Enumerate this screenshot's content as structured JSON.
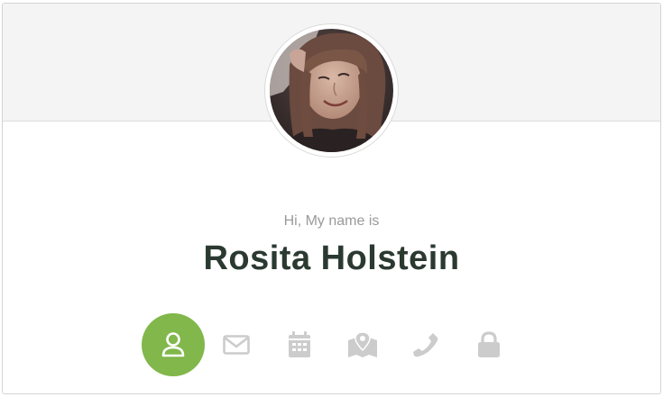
{
  "profile": {
    "greeting": "Hi, My name is",
    "name": "Rosita Holstein"
  },
  "nav_icons": [
    {
      "icon": "user-icon",
      "active": true
    },
    {
      "icon": "envelope-icon",
      "active": false
    },
    {
      "icon": "calendar-icon",
      "active": false
    },
    {
      "icon": "map-icon",
      "active": false
    },
    {
      "icon": "phone-icon",
      "active": false
    },
    {
      "icon": "lock-icon",
      "active": false
    }
  ],
  "colors": {
    "accent": "#81b74b",
    "icon_inactive": "#cccccc",
    "name_text": "#2b3a31",
    "greeting_text": "#9a9a9a",
    "header_bg": "#f4f4f4"
  }
}
